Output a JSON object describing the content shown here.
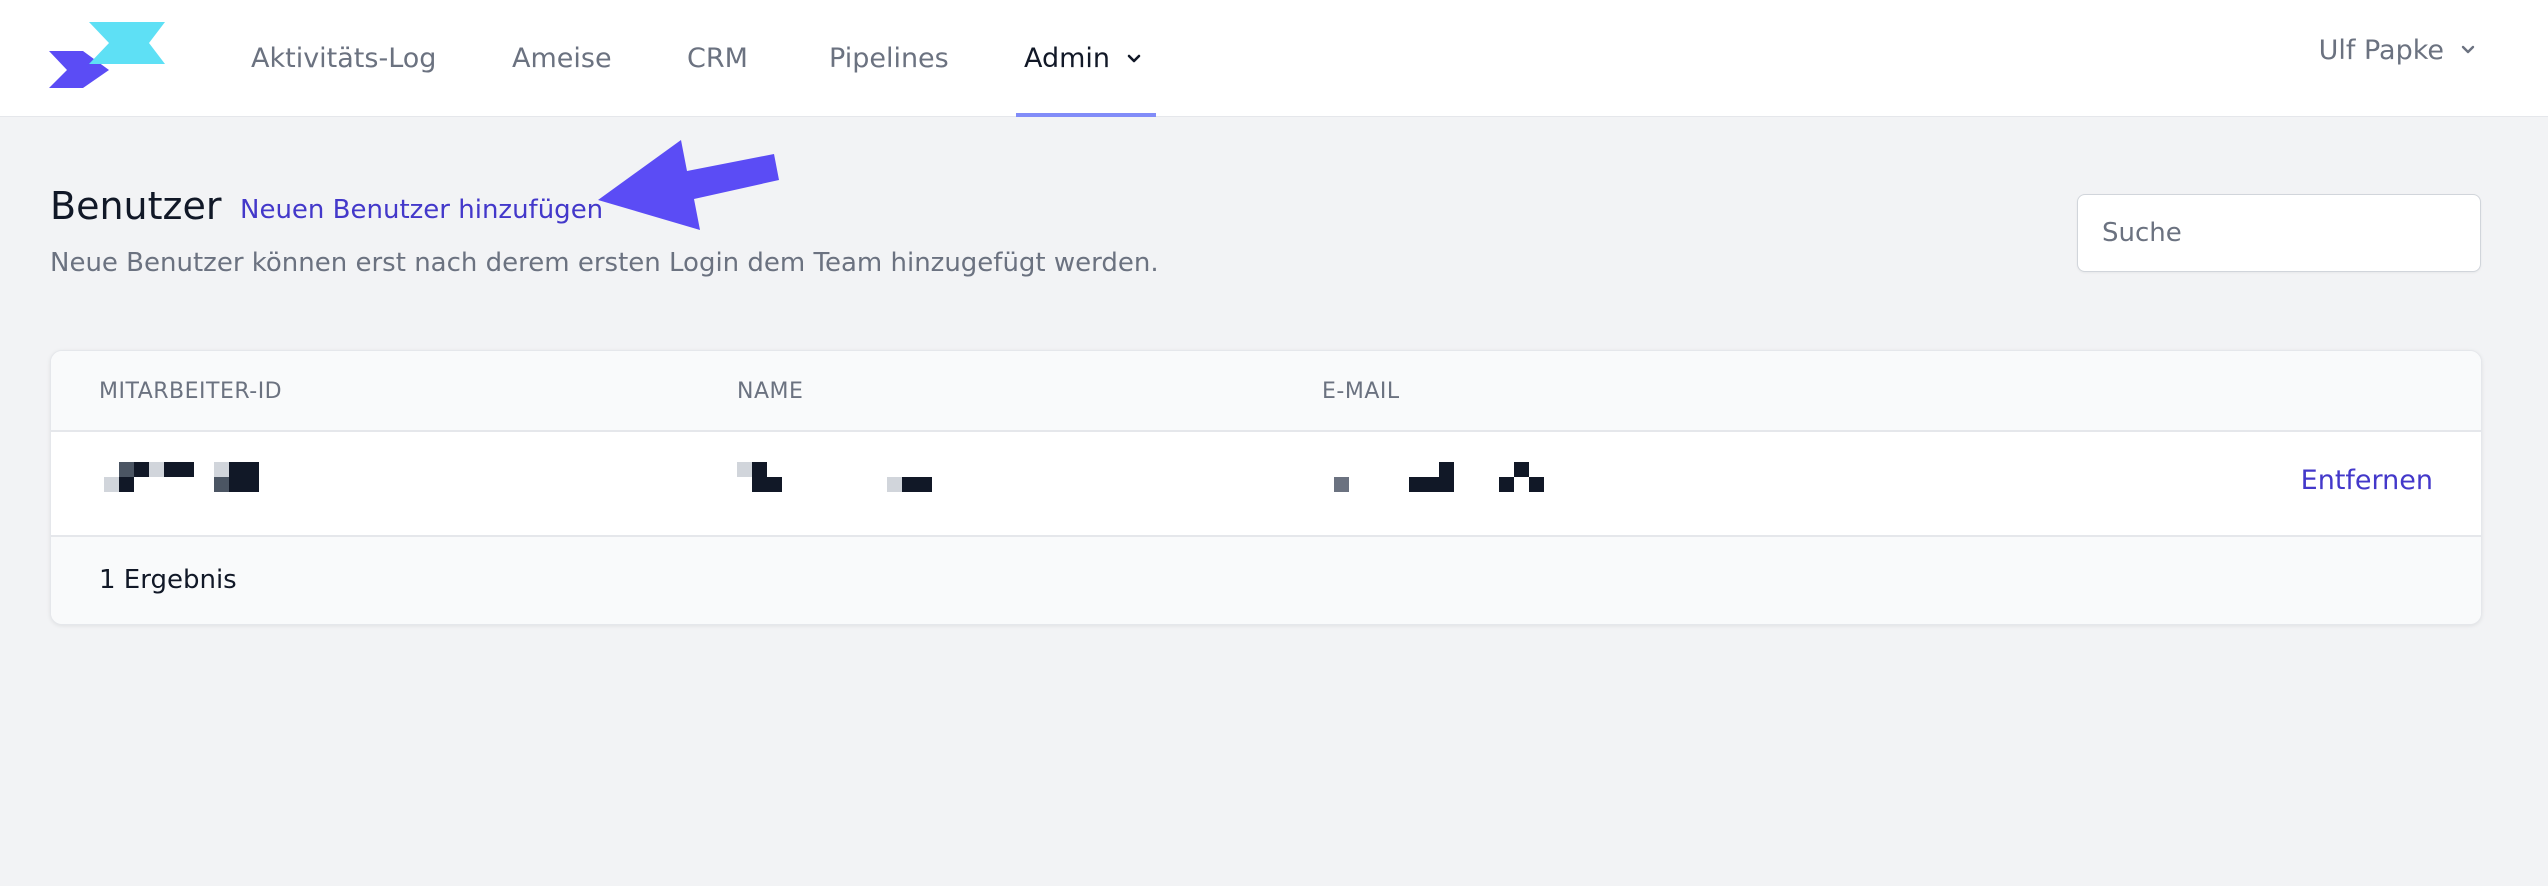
{
  "nav": {
    "items": [
      {
        "label": "Aktivitäts-Log"
      },
      {
        "label": "Ameise"
      },
      {
        "label": "CRM"
      },
      {
        "label": "Pipelines"
      },
      {
        "label": "Admin"
      }
    ],
    "active_item": "Admin",
    "user_name": "Ulf Papke"
  },
  "page": {
    "title": "Benutzer",
    "add_link": "Neuen Benutzer hinzufügen",
    "subtitle": "Neue Benutzer können erst nach derem ersten Login dem Team hinzugefügt werden."
  },
  "search": {
    "placeholder": "Suche",
    "value": ""
  },
  "table": {
    "columns": [
      "MITARBEITER-ID",
      "NAME",
      "E-MAIL"
    ],
    "rows": [
      {
        "id": "",
        "name": "",
        "email": "",
        "action": "Entfernen"
      }
    ],
    "footer": "1 Ergebnis"
  },
  "colors": {
    "accent": "#4338ca",
    "nav_underline": "#818cf8",
    "arrow": "#5b4cf5",
    "logo_primary": "#5b4cf5",
    "logo_secondary": "#5ee0f5"
  },
  "icons": {
    "logo": "brand-logo",
    "dropdown": "chevron-down-icon",
    "annotation": "arrow-pointer-icon"
  }
}
